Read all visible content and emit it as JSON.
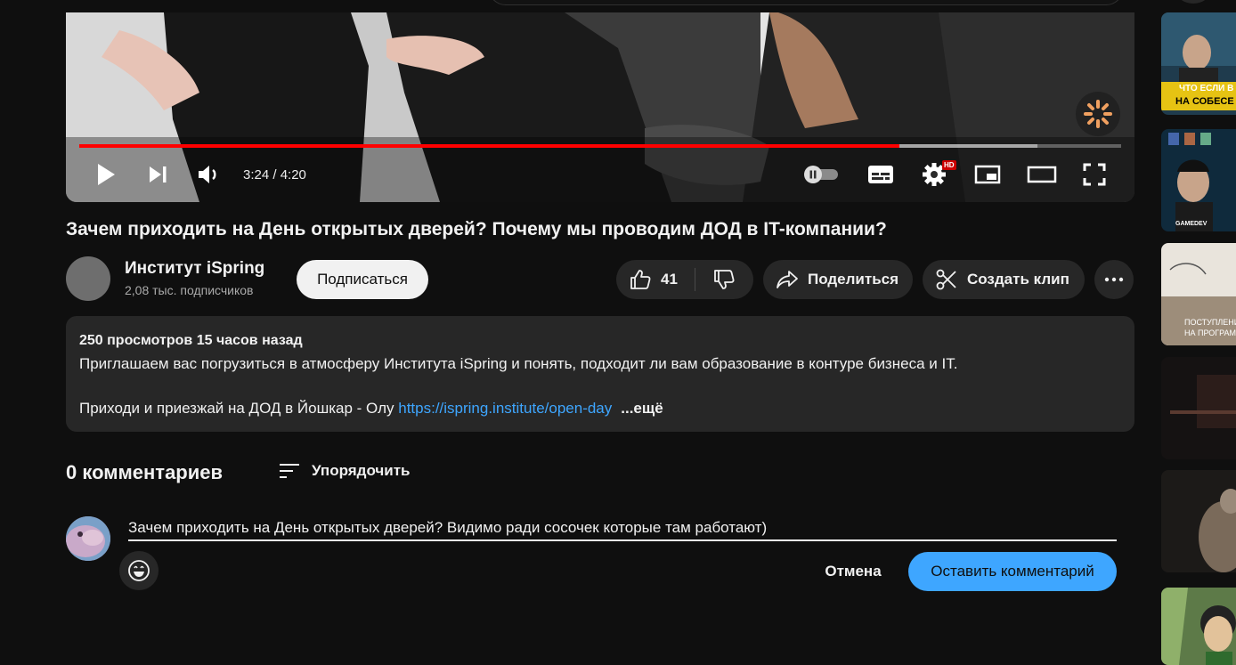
{
  "player": {
    "time": "3:24 / 4:20",
    "progress_fraction": 0.787,
    "buffered_fraction": 0.92,
    "quality_badge": "HD",
    "accent": "#ff0000"
  },
  "video": {
    "title": "Зачем приходить на День открытых дверей? Почему мы проводим ДОД в IT-компании?"
  },
  "channel": {
    "name": "Институт iSpring",
    "subscribers": "2,08 тыс. подписчиков",
    "subscribe_label": "Подписаться"
  },
  "actions": {
    "likes": "41",
    "share_label": "Поделиться",
    "clip_label": "Создать клип"
  },
  "description": {
    "stats": "250 просмотров  15 часов назад",
    "line1": "Приглашаем вас погрузиться в атмосферу Института iSpring и понять, подходит ли вам образование в контуре бизнеса и IT.",
    "line2": "Приходи и приезжай на ДОД в Йошкар - Олу ",
    "link": "https://ispring.institute/open-day",
    "more": "...ещё"
  },
  "comments": {
    "count_label": "0 комментариев",
    "sort_label": "Упорядочить",
    "input_value": "Зачем приходить на День открытых дверей? Видимо ради сосочек которые там работают)",
    "cancel_label": "Отмена",
    "submit_label": "Оставить комментарий",
    "submit_color": "#3ea6ff"
  },
  "sidebar": {
    "thumb1_text_a": "ЧТО ЕСЛИ В",
    "thumb1_text_b": "НА СОБЕСЕ",
    "thumb2_text": "GAMEDEV",
    "thumb3_text_a": "ПОСТУПЛЕНИЕ В",
    "thumb3_text_b": "НА ПРОГРАМ"
  }
}
